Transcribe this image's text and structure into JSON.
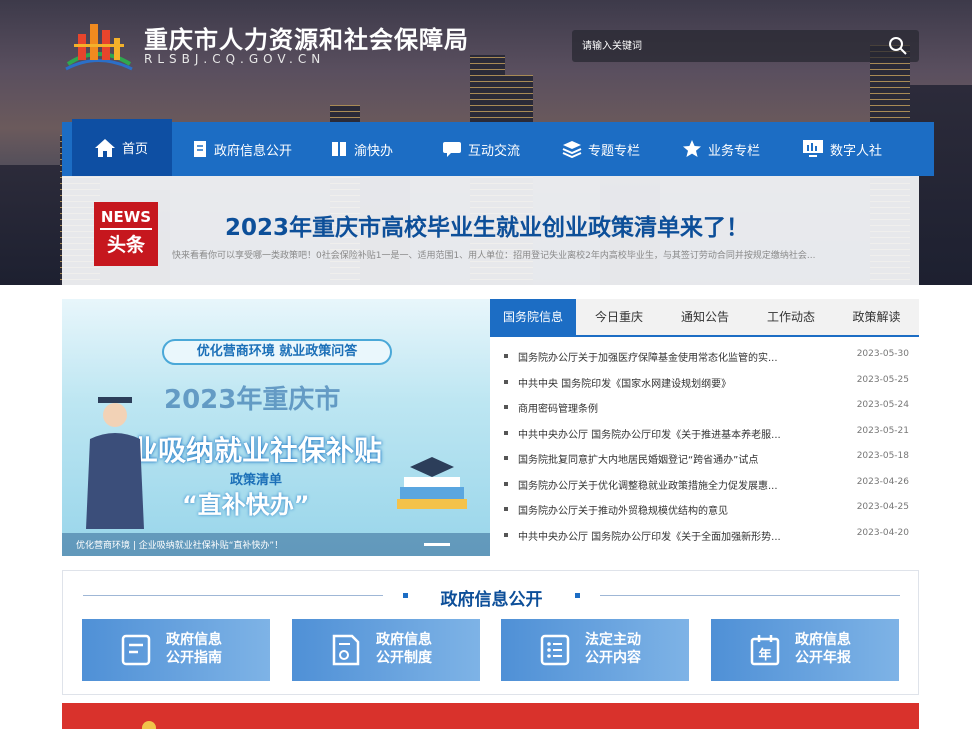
{
  "header": {
    "site_title": "重庆市人力资源和社会保障局",
    "site_url": "RLSBJ.CQ.GOV.CN",
    "search_placeholder": "请输入关键词"
  },
  "nav": [
    {
      "label": "首页",
      "icon": "home-icon",
      "active": true
    },
    {
      "label": "政府信息公开",
      "icon": "document-icon"
    },
    {
      "label": "渝快办",
      "icon": "book-icon"
    },
    {
      "label": "互动交流",
      "icon": "chat-icon"
    },
    {
      "label": "专题专栏",
      "icon": "layers-icon"
    },
    {
      "label": "业务专栏",
      "icon": "star-icon"
    },
    {
      "label": "数字人社",
      "icon": "monitor-icon"
    }
  ],
  "headline": {
    "badge_en": "NEWS",
    "badge_cn": "头条",
    "title": "2023年重庆市高校毕业生就业创业政策清单来了！",
    "summary": "快来看看你可以享受哪一类政策吧！0社会保险补贴1一是一、适用范围1、用人单位：招用登记失业离校2年内高校毕业生，与其签订劳动合同并按规定缴纳社会..."
  },
  "banner": {
    "pill": "优化营商环境 就业政策问答",
    "year_line": "2023年重庆市",
    "main_line": "企业吸纳就业社保补贴",
    "sub_line": "政策清单",
    "slogan": "“直补快办”",
    "caption": "优化营商环境 | 企业吸纳就业社保补贴“直补快办”！"
  },
  "tabs": [
    {
      "label": "国务院信息",
      "active": true
    },
    {
      "label": "今日重庆"
    },
    {
      "label": "通知公告"
    },
    {
      "label": "工作动态"
    },
    {
      "label": "政策解读"
    }
  ],
  "news_list": [
    {
      "title": "国务院办公厅关于加强医疗保障基金使用常态化监管的实...",
      "date": "2023-05-30"
    },
    {
      "title": "中共中央 国务院印发《国家水网建设规划纲要》",
      "date": "2023-05-25"
    },
    {
      "title": "商用密码管理条例",
      "date": "2023-05-24"
    },
    {
      "title": "中共中央办公厅 国务院办公厅印发《关于推进基本养老服...",
      "date": "2023-05-21"
    },
    {
      "title": "国务院批复同意扩大内地居民婚姻登记“跨省通办”试点",
      "date": "2023-05-18"
    },
    {
      "title": "国务院办公厅关于优化调整稳就业政策措施全力促发展惠...",
      "date": "2023-04-26"
    },
    {
      "title": "国务院办公厅关于推动外贸稳规模优结构的意见",
      "date": "2023-04-25"
    },
    {
      "title": "中共中央办公厅 国务院办公厅印发《关于全面加强新形势...",
      "date": "2023-04-20"
    }
  ],
  "gov_info": {
    "title": "政府信息公开",
    "cards": [
      {
        "line1": "政府信息",
        "line2": "公开指南",
        "icon": "guide-icon"
      },
      {
        "line1": "政府信息",
        "line2": "公开制度",
        "icon": "regulation-icon"
      },
      {
        "line1": "法定主动",
        "line2": "公开内容",
        "icon": "list-icon"
      },
      {
        "line1": "政府信息",
        "line2": "公开年报",
        "icon": "calendar-icon",
        "icon_text": "年"
      }
    ]
  },
  "colors": {
    "primary": "#1c6dc4",
    "active": "#0e4fa3",
    "headline": "#0d4f99",
    "news_red": "#c6171e"
  }
}
